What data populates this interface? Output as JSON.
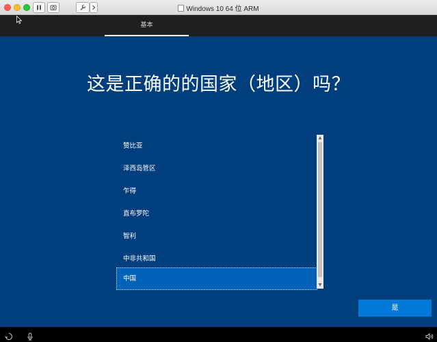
{
  "titlebar": {
    "title": "Windows 10 64 位 ARM",
    "icons": [
      "pause-icon",
      "snapshot-icon",
      "wrench-icon",
      "chevron-right-icon"
    ]
  },
  "oobe": {
    "tab_label": "基本",
    "heading": "这是正确的的国家（地区）吗？",
    "regions": [
      "赞比亚",
      "泽西岛管区",
      "乍得",
      "直布罗陀",
      "智利",
      "中非共和国",
      "中国"
    ],
    "selected_region": "中国",
    "yes_label": "是"
  },
  "bottombar": {
    "icons": [
      "ease-of-access-icon",
      "microphone-icon",
      "volume-icon"
    ]
  },
  "colors": {
    "background": "#003e7e",
    "selection": "#0062b8",
    "button": "#0078d7"
  }
}
